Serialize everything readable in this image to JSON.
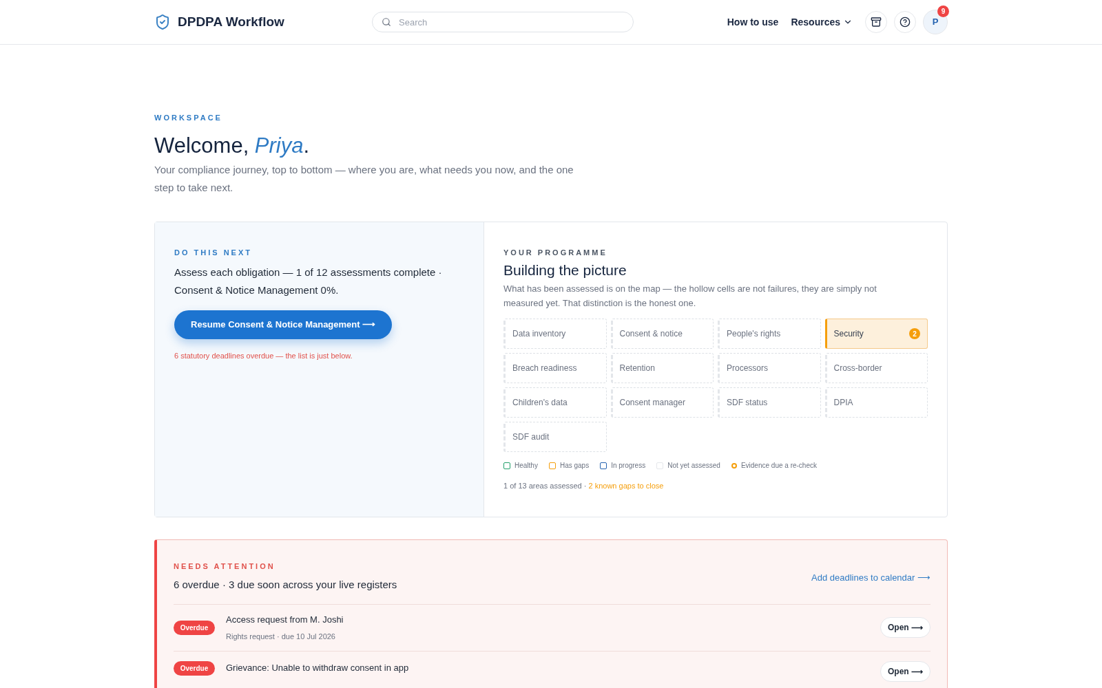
{
  "header": {
    "brand": "DPDPA Workflow",
    "search": {
      "placeholder": "Search"
    },
    "nav": [
      {
        "label": "How to use",
        "kind": "link"
      },
      {
        "label": "Resources",
        "kind": "dropdown"
      }
    ],
    "avatar": {
      "initial": "P",
      "badge": "9"
    }
  },
  "intro": {
    "eyebrow": "WORKSPACE",
    "greeting": "Welcome, ",
    "name": "Priya",
    "punct": ".",
    "subtitle": "Your compliance journey, top to bottom — where you are, what needs you now, and the one step to take next."
  },
  "next": {
    "eyebrow": "DO THIS NEXT",
    "text": "Assess each obligation — 1 of 12 assessments complete · Consent & Notice Management 0%.",
    "button": "Resume Consent & Notice Management ⟶",
    "warning": "6 statutory deadlines overdue — the list is just below."
  },
  "programme": {
    "eyebrow": "YOUR PROGRAMME",
    "title": "Building the picture",
    "description": "What has been assessed is on the map — the hollow cells are not failures, they are simply not measured yet. That distinction is the honest one.",
    "areas": [
      {
        "label": "Data inventory",
        "kind": "hollow"
      },
      {
        "label": "Consent & notice",
        "kind": "hollow"
      },
      {
        "label": "People's rights",
        "kind": "hollow"
      },
      {
        "label": "Security",
        "kind": "gaps",
        "badge": "2"
      },
      {
        "label": "Breach readiness",
        "kind": "hollow"
      },
      {
        "label": "Retention",
        "kind": "hollow"
      },
      {
        "label": "Processors",
        "kind": "hollow"
      },
      {
        "label": "Cross-border",
        "kind": "hollow"
      },
      {
        "label": "Children's data",
        "kind": "hollow"
      },
      {
        "label": "Consent manager",
        "kind": "hollow"
      },
      {
        "label": "SDF status",
        "kind": "hollow"
      },
      {
        "label": "DPIA",
        "kind": "hollow"
      },
      {
        "label": "SDF audit",
        "kind": "hollow"
      }
    ],
    "legend": [
      {
        "label": "Healthy",
        "kind": "square",
        "color": "#22a06b"
      },
      {
        "label": "Has gaps",
        "kind": "square",
        "color": "#f59e0b"
      },
      {
        "label": "In progress",
        "kind": "square",
        "color": "#2563b0"
      },
      {
        "label": "Not yet assessed",
        "kind": "square",
        "color": "#e5e7eb"
      },
      {
        "label": "Evidence due a re-check",
        "kind": "ring",
        "color": "#f59e0b"
      }
    ],
    "summary": "1 of 13 areas assessed · ",
    "summary_highlight": "2 known gaps to close"
  },
  "attention": {
    "eyebrow": "NEEDS ATTENTION",
    "summary": "6 overdue · 3 due soon across your live registers",
    "calendar_link": "Add deadlines to calendar ⟶",
    "items": [
      {
        "status": "Overdue",
        "title": "Access request from M. Joshi",
        "meta": "Rights request · due 10 Jul 2026",
        "action": "Open ⟶"
      },
      {
        "status": "Overdue",
        "title": "Grievance: Unable to withdraw consent in app",
        "action": "Open ⟶"
      }
    ]
  }
}
